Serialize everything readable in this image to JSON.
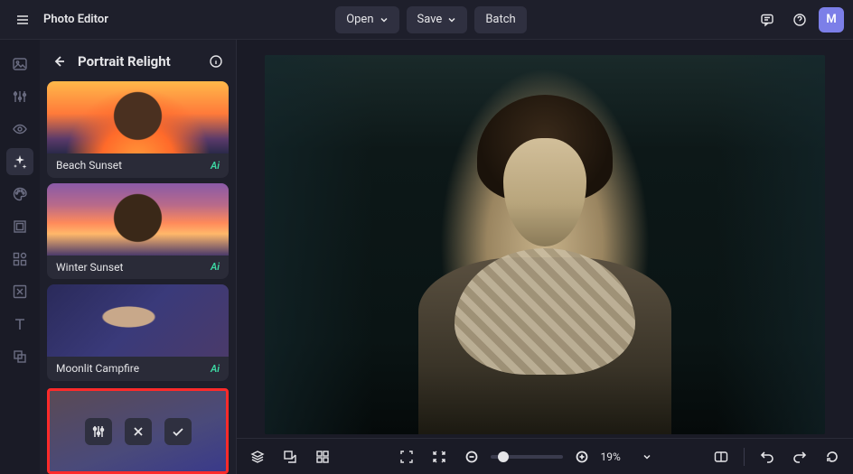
{
  "app": {
    "title": "Photo Editor"
  },
  "topbar": {
    "open": "Open",
    "save": "Save",
    "batch": "Batch",
    "avatar_initial": "M"
  },
  "panel": {
    "title": "Portrait Relight",
    "ai_badge": "Ai",
    "presets": [
      {
        "label": "Beach Sunset"
      },
      {
        "label": "Winter Sunset"
      },
      {
        "label": "Moonlit Campfire"
      }
    ]
  },
  "zoom": {
    "value": "19%"
  },
  "colors": {
    "highlight_border": "#ff2a2a",
    "ai_badge": "#3dd9a4",
    "accent": "#7c7fe8"
  }
}
